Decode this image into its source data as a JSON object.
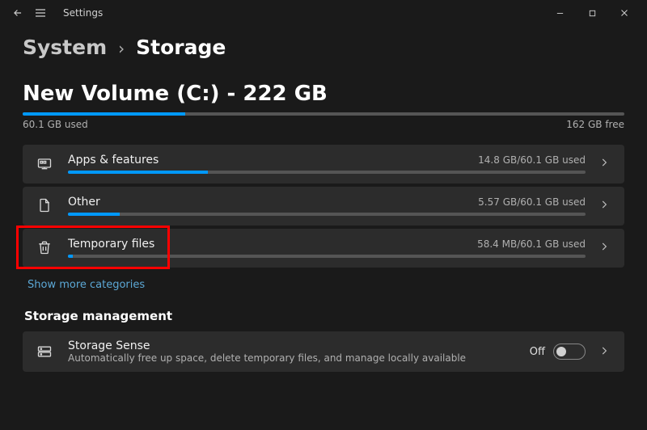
{
  "window": {
    "title": "Settings"
  },
  "breadcrumb": {
    "parent": "System",
    "separator": "›",
    "current": "Storage"
  },
  "drive": {
    "title": "New Volume (C:) - 222 GB",
    "used_label": "60.1 GB used",
    "free_label": "162 GB free",
    "used_percent": 27
  },
  "categories": [
    {
      "name": "Apps & features",
      "usage": "14.8 GB/60.1 GB used",
      "fill_percent": 27,
      "icon": "apps"
    },
    {
      "name": "Other",
      "usage": "5.57 GB/60.1 GB used",
      "fill_percent": 10,
      "icon": "file"
    },
    {
      "name": "Temporary files",
      "usage": "58.4 MB/60.1 GB used",
      "fill_percent": 1,
      "icon": "trash",
      "highlighted": true
    }
  ],
  "show_more": "Show more categories",
  "management": {
    "heading": "Storage management",
    "sense": {
      "title": "Storage Sense",
      "description": "Automatically free up space, delete temporary files, and manage locally available",
      "toggle_label": "Off",
      "toggle_on": false,
      "icon": "drive"
    }
  }
}
